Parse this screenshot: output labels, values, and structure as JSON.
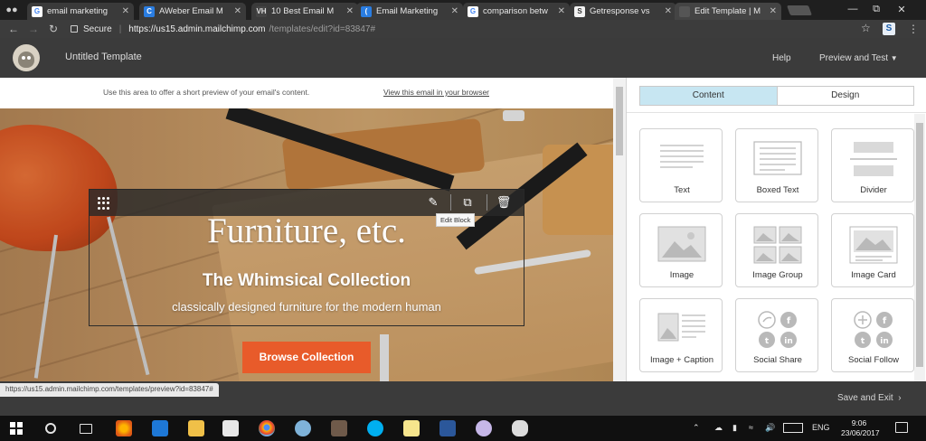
{
  "browser": {
    "tabs": [
      {
        "title": "email marketing",
        "favicon": "google-icon",
        "color": "#ffffff",
        "glyph": "G",
        "glyph_color": "#4285f4"
      },
      {
        "title": "AWeber Email M",
        "favicon": "aweber-icon",
        "color": "#2a7de1",
        "glyph": "C",
        "glyph_color": "#ffffff"
      },
      {
        "title": "10 Best Email M",
        "favicon": "vh-icon",
        "color": "#444444",
        "glyph": "VH",
        "glyph_color": "#dddddd"
      },
      {
        "title": "Email Marketing",
        "favicon": "wordpress-icon",
        "color": "#2a7de1",
        "glyph": "(",
        "glyph_color": "#ffffff"
      },
      {
        "title": "comparison betw",
        "favicon": "google-icon",
        "color": "#ffffff",
        "glyph": "G",
        "glyph_color": "#4285f4"
      },
      {
        "title": "Getresponse vs",
        "favicon": "document-icon",
        "color": "#f2f2f2",
        "glyph": "S",
        "glyph_color": "#333333"
      },
      {
        "title": "Edit Template | M",
        "favicon": "mailchimp-icon",
        "color": "#555555",
        "glyph": "",
        "glyph_color": "#ffffff"
      }
    ],
    "secure_label": "Secure",
    "url_host": "https://us15.admin.mailchimp.com",
    "url_path": "/templates/edit?id=83847#",
    "extension_glyph": "S",
    "status_url": "https://us15.admin.mailchimp.com/templates/preview?id=83847#"
  },
  "mailchimp": {
    "template_title": "Untitled Template",
    "help_label": "Help",
    "preview_label": "Preview and Test",
    "save_exit_label": "Save and Exit"
  },
  "canvas": {
    "preheader_text": "Use this area to offer a short preview of your email's content.",
    "view_in_browser": "View this email in your browser",
    "tooltip": "Edit Block",
    "headline": "Furniture, etc.",
    "subheadline": "The Whimsical Collection",
    "tagline": "classically designed furniture for the modern human",
    "button_label": "Browse Collection"
  },
  "panel": {
    "tabs": [
      {
        "label": "Content",
        "active": true
      },
      {
        "label": "Design",
        "active": false
      }
    ],
    "blocks": [
      {
        "label": "Text",
        "icon": "text-block-icon"
      },
      {
        "label": "Boxed Text",
        "icon": "boxed-text-block-icon"
      },
      {
        "label": "Divider",
        "icon": "divider-block-icon"
      },
      {
        "label": "Image",
        "icon": "image-block-icon"
      },
      {
        "label": "Image Group",
        "icon": "image-group-block-icon"
      },
      {
        "label": "Image Card",
        "icon": "image-card-block-icon"
      },
      {
        "label": "Image + Caption",
        "icon": "image-caption-block-icon"
      },
      {
        "label": "Social Share",
        "icon": "social-share-block-icon"
      },
      {
        "label": "Social Follow",
        "icon": "social-follow-block-icon"
      }
    ]
  },
  "taskbar": {
    "language": "ENG",
    "time": "9:06",
    "date": "23/06/2017"
  },
  "colors": {
    "accent_orange": "#e85b2a",
    "content_tab_active": "#c7e6f2",
    "header_dark": "#3b3b3b"
  }
}
